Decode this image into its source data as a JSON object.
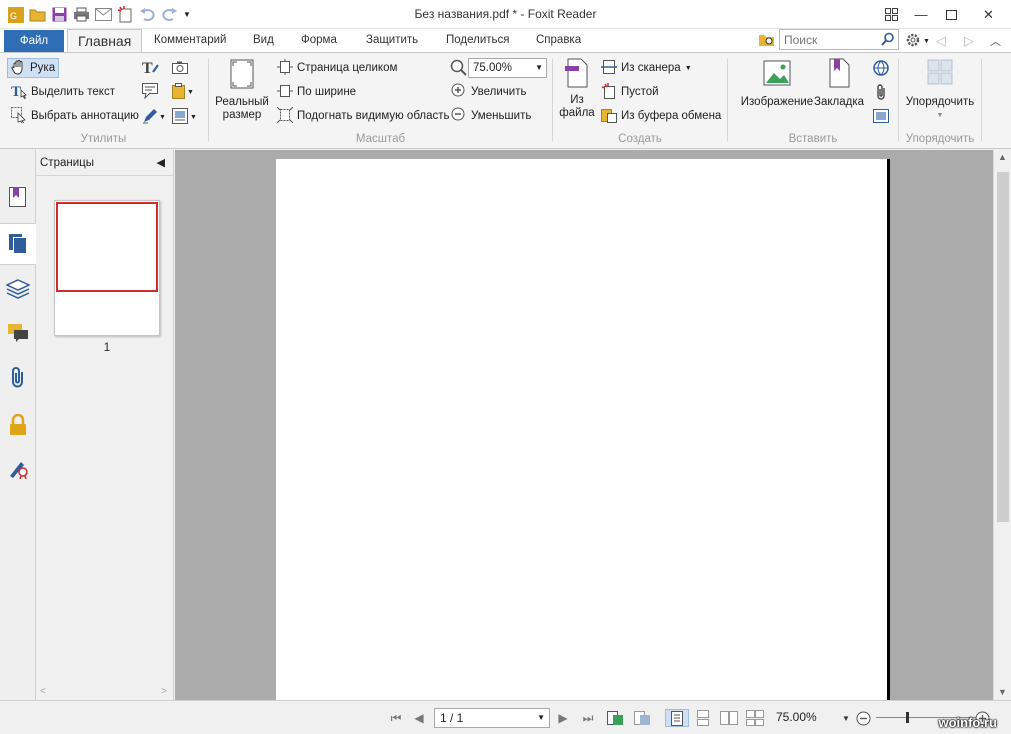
{
  "window": {
    "title": "Без названия.pdf * - Foxit Reader"
  },
  "tabs": [
    {
      "label": "Файл"
    },
    {
      "label": "Главная"
    },
    {
      "label": "Комментарий"
    },
    {
      "label": "Вид"
    },
    {
      "label": "Форма"
    },
    {
      "label": "Защитить"
    },
    {
      "label": "Поделиться"
    },
    {
      "label": "Справка"
    }
  ],
  "search": {
    "placeholder": "Поиск"
  },
  "ribbon": {
    "tools": {
      "label": "Утилиты",
      "hand": "Рука",
      "select_text": "Выделить текст",
      "select_annotation": "Выбрать аннотацию"
    },
    "zoom": {
      "label": "Масштаб",
      "actual_size": "Реальный размер",
      "actual_size_l1": "Реальный",
      "actual_size_l2": "размер",
      "fit_page": "Страница целиком",
      "fit_width": "По ширине",
      "fit_visible": "Подогнать видимую область",
      "value": "75.00%",
      "zoom_in": "Увеличить",
      "zoom_out": "Уменьшить"
    },
    "create": {
      "label": "Создать",
      "from_file_l1": "Из",
      "from_file_l2": "файла",
      "from_scanner": "Из сканера",
      "blank": "Пустой",
      "from_clipboard": "Из буфера обмена"
    },
    "insert": {
      "label": "Вставить",
      "image": "Изображение",
      "bookmark": "Закладка"
    },
    "arrange": {
      "label": "Упорядочить",
      "button": "Упорядочить"
    }
  },
  "panel": {
    "title": "Страницы",
    "thumb_number": "1"
  },
  "status": {
    "page": "1 / 1",
    "zoom": "75.00%"
  },
  "watermark": "woinfo.ru",
  "colors": {
    "file_tab": "#2f6db4",
    "selection_border": "#d12c2c",
    "doc_background": "#ababab"
  }
}
